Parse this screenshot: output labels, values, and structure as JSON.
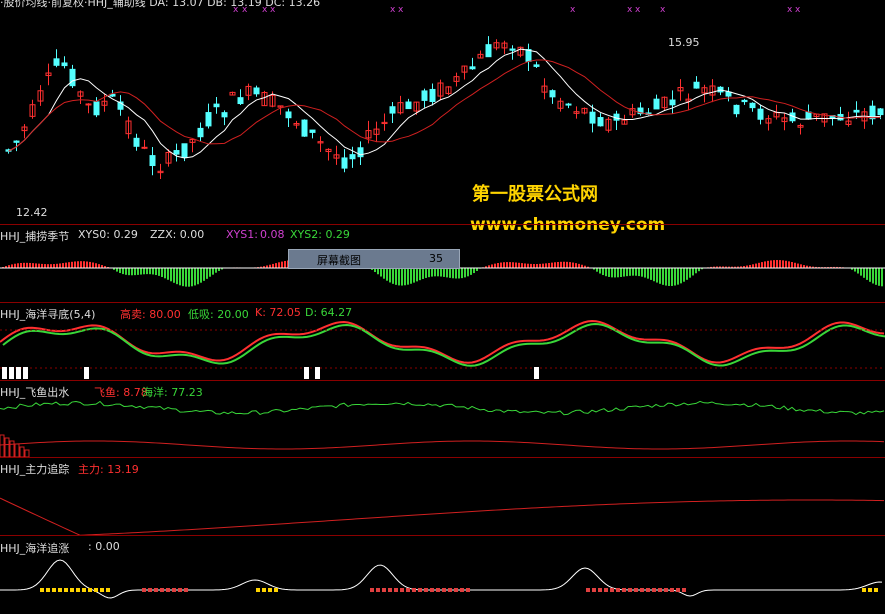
{
  "top": {
    "header": "·股价均线·前复权·HHJ_辅助线  DA: 13.07  DB: 13.19  DC: 13.26",
    "high_label": "15.95",
    "low_label": "12.42"
  },
  "watermark": {
    "line1": "第一股票公式网",
    "line2": "www.chnmoney.com"
  },
  "panel1": {
    "title": "HHJ_捕捞季节",
    "xys0": "XYS0: 0.29",
    "zzx": "ZZX: 0.00",
    "xys1_label": "XYS1: ",
    "xys1_val": "0.08",
    "xys2": "XYS2: 0.29",
    "screenshot_button": "屏幕截图",
    "screenshot_num": "35"
  },
  "panel2": {
    "title": "HHJ_海洋寻底(5,4)",
    "sell": "高卖: 80.00",
    "buy": "低吸: 20.00",
    "k": "K: 72.05",
    "d": "D: 64.27"
  },
  "panel3": {
    "title": "HHJ_飞鱼出水",
    "fish": "飞鱼: 8.78",
    "ocean": "海洋: 77.23"
  },
  "panel4": {
    "title": "HHJ_主力追踪",
    "main": "主力: 13.19"
  },
  "panel5": {
    "title": "HHJ_海洋追涨",
    "value": ": 0.00"
  },
  "colors": {
    "up": "#ff3030",
    "down": "#54ffff",
    "separator": "#8a0000",
    "green": "#39d739",
    "watermark": "#ffd400"
  }
}
